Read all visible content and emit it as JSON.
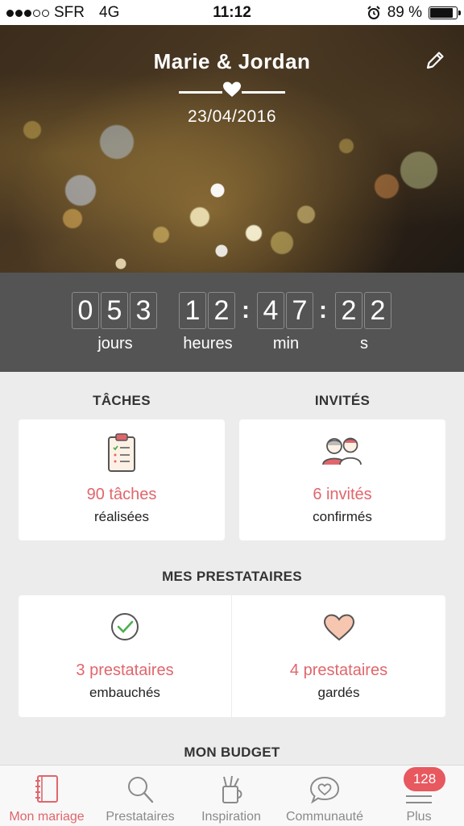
{
  "status_bar": {
    "carrier": "SFR",
    "network": "4G",
    "time": "11:12",
    "battery": "89 %"
  },
  "hero": {
    "couple": "Marie & Jordan",
    "date": "23/04/2016"
  },
  "countdown": {
    "days": [
      "0",
      "5",
      "3"
    ],
    "hours": [
      "1",
      "2"
    ],
    "minutes": [
      "4",
      "7"
    ],
    "seconds": [
      "2",
      "2"
    ],
    "labels": {
      "days": "jours",
      "hours": "heures",
      "minutes": "min",
      "seconds": "s"
    }
  },
  "tasks": {
    "title": "TÂCHES",
    "count": "90 tâches",
    "subtitle": "réalisées",
    "icon": "clipboard-icon"
  },
  "guests": {
    "title": "INVITÉS",
    "count": "6 invités",
    "subtitle": "confirmés",
    "icon": "people-icon"
  },
  "vendors": {
    "title": "MES PRESTATAIRES",
    "hired": {
      "count": "3 prestataires",
      "subtitle": "embauchés",
      "icon": "checkmark-circle-icon"
    },
    "saved": {
      "count": "4 prestataires",
      "subtitle": "gardés",
      "icon": "heart-icon"
    }
  },
  "budget": {
    "title": "MON BUDGET"
  },
  "tabbar": {
    "tabs": [
      {
        "label": "Mon mariage",
        "icon": "notebook-icon",
        "active": true
      },
      {
        "label": "Prestataires",
        "icon": "search-icon"
      },
      {
        "label": "Inspiration",
        "icon": "pencil-cup-icon"
      },
      {
        "label": "Communauté",
        "icon": "chat-heart-icon"
      },
      {
        "label": "Plus",
        "icon": "menu-icon",
        "badge": "128"
      }
    ]
  },
  "colors": {
    "accent": "#e0666c",
    "countdown_bg": "#545454",
    "background": "#ececec"
  }
}
